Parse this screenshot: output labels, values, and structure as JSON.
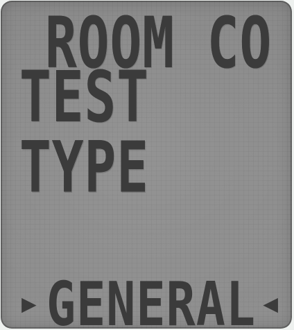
{
  "display": {
    "title_line_1": "ROOM CO",
    "title_line_2": "TEST TYPE",
    "selection": {
      "left_marker": "▶",
      "value": "GENERAL",
      "right_marker": "◀"
    }
  }
}
